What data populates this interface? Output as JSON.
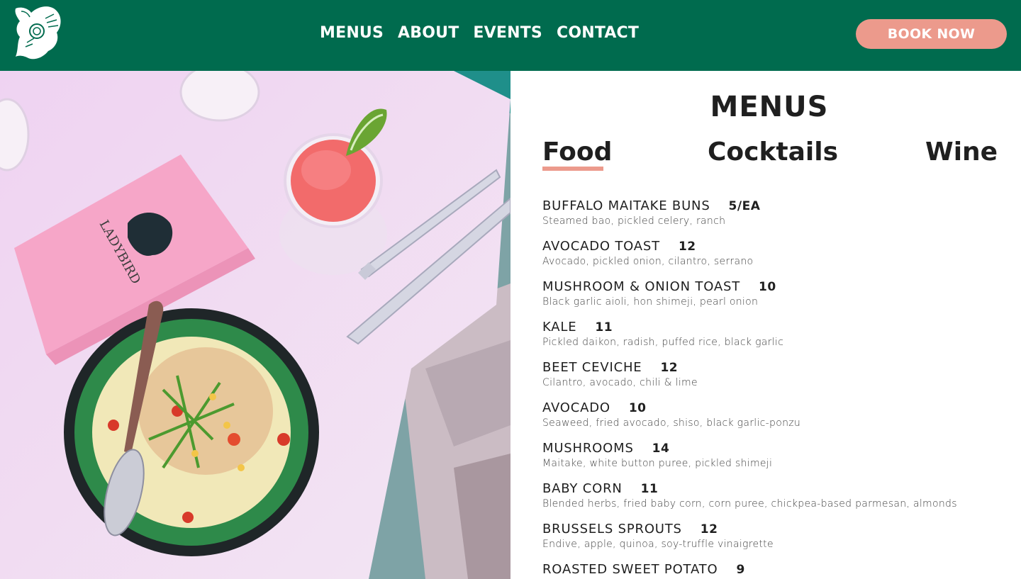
{
  "colors": {
    "header_bg": "#006b4e",
    "accent": "#ec9a8c",
    "text": "#1f1f1f"
  },
  "header": {
    "logo_icon": "ladybird-bird-logo-icon",
    "nav": [
      "MENUS",
      "ABOUT",
      "EVENTS",
      "CONTACT"
    ],
    "book_label": "BOOK NOW"
  },
  "photo": {
    "icon": "food-photo"
  },
  "menu": {
    "title": "MENUS",
    "tabs": [
      "Food",
      "Cocktails",
      "Wine"
    ],
    "active_tab": "Food",
    "items": [
      {
        "name": "BUFFALO MAITAKE BUNS",
        "price": "5/EA",
        "desc": "Steamed bao, pickled celery, ranch"
      },
      {
        "name": "AVOCADO TOAST",
        "price": "12",
        "desc": "Avocado, pickled onion, cilantro, serrano"
      },
      {
        "name": "MUSHROOM & ONION TOAST",
        "price": "10",
        "desc": "Black garlic aioli, hon shimeji, pearl onion"
      },
      {
        "name": "KALE",
        "price": "11",
        "desc": "Pickled daikon, radish, puffed rice, black garlic"
      },
      {
        "name": "BEET CEVICHE",
        "price": "12",
        "desc": "Cilantro, avocado, chili & lime"
      },
      {
        "name": "AVOCADO",
        "price": "10",
        "desc": "Seaweed, fried avocado, shiso, black garlic-ponzu"
      },
      {
        "name": "MUSHROOMS",
        "price": "14",
        "desc": "Maitake, white button puree, pickled shimeji"
      },
      {
        "name": "BABY CORN",
        "price": "11",
        "desc": "Blended herbs, fried baby corn, corn puree, chickpea-based parmesan, almonds"
      },
      {
        "name": "BRUSSELS SPROUTS",
        "price": "12",
        "desc": "Endive, apple, quinoa, soy-truffle vinaigrette"
      },
      {
        "name": "ROASTED SWEET POTATO",
        "price": "9",
        "desc": ""
      }
    ]
  }
}
